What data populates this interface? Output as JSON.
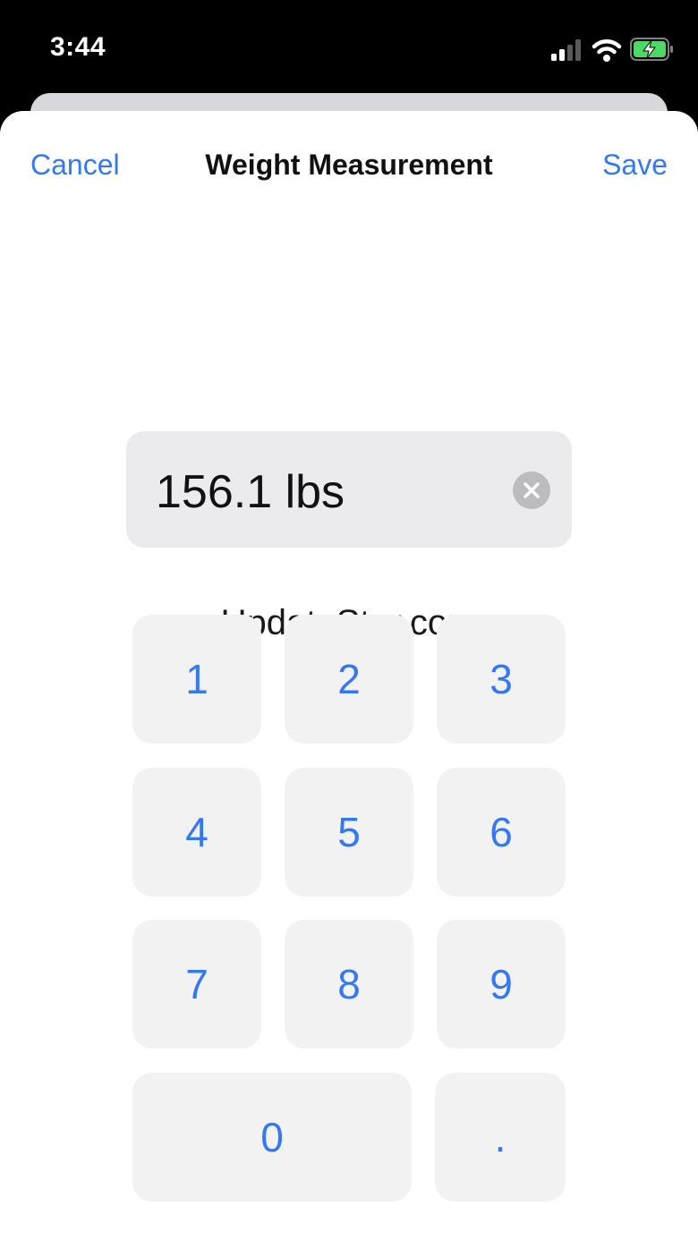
{
  "status_bar": {
    "time": "3:44"
  },
  "nav": {
    "cancel_label": "Cancel",
    "title": "Weight Measurement",
    "save_label": "Save"
  },
  "value_field": {
    "value": "156.1 lbs"
  },
  "watermark": "UpdateStar.com",
  "keypad": {
    "keys": [
      "1",
      "2",
      "3",
      "4",
      "5",
      "6",
      "7",
      "8",
      "9",
      "0",
      "."
    ]
  },
  "colors": {
    "accent": "#3478f6",
    "battery": "#4cd964"
  },
  "icons": [
    "signal-icon",
    "wifi-icon",
    "battery-charging-icon",
    "clear-icon"
  ]
}
